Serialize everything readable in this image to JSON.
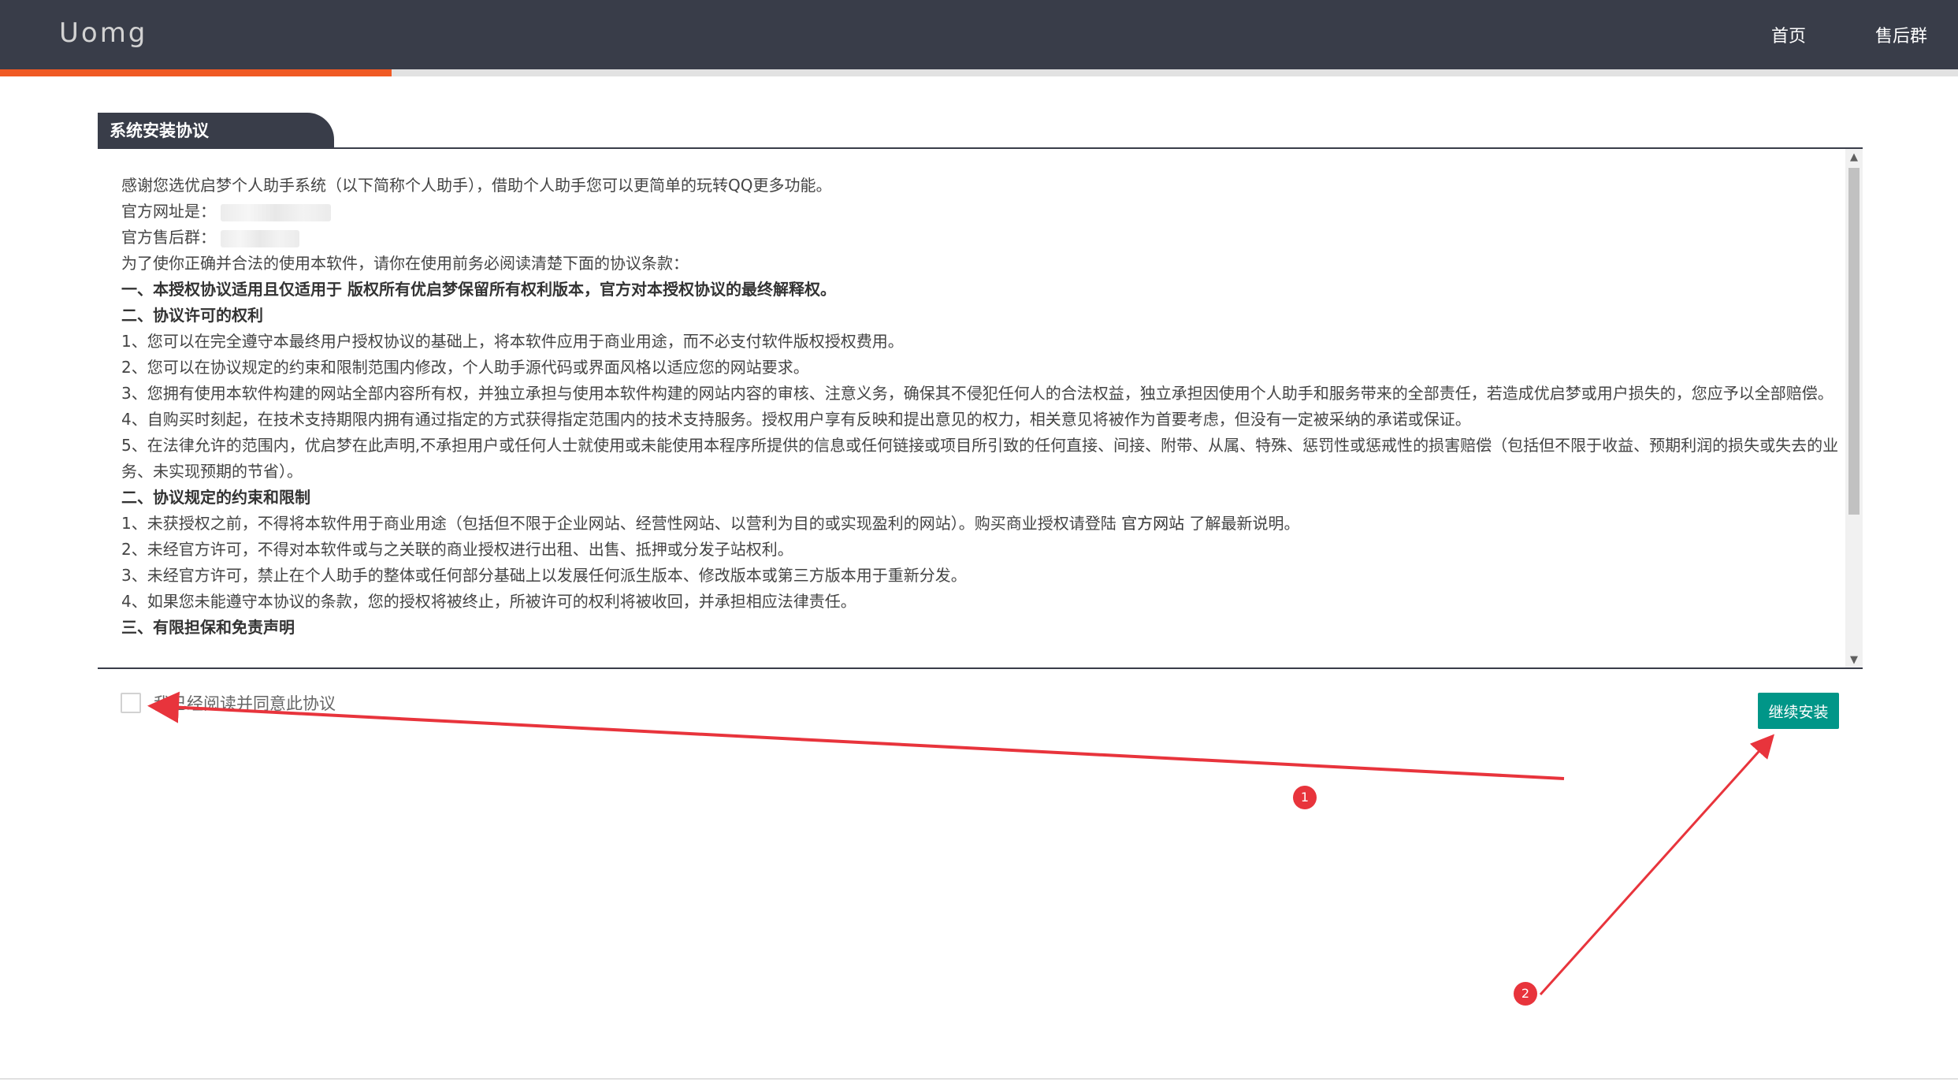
{
  "app": {
    "logo": "Uomg"
  },
  "nav": [
    {
      "label": "首页"
    },
    {
      "label": "售后群"
    }
  ],
  "progress": {
    "percent": 20,
    "color": "#f05a24"
  },
  "panel": {
    "title": "系统安装协议"
  },
  "agreement": {
    "intro": "感谢您选优启梦个人助手系统（以下简称个人助手），借助个人助手您可以更简单的玩转QQ更多功能。",
    "site_label": "官方网址是：",
    "group_label": "官方售后群：",
    "notice": "为了使你正确并合法的使用本软件，请你在使用前务必阅读清楚下面的协议条款：",
    "s1": "一、本授权协议适用且仅适用于 版权所有优启梦保留所有权利版本，官方对本授权协议的最终解释权。",
    "s2": "二、协议许可的权利",
    "s2_1": "1、您可以在完全遵守本最终用户授权协议的基础上，将本软件应用于商业用途，而不必支付软件版权授权费用。",
    "s2_2": "2、您可以在协议规定的约束和限制范围内修改，个人助手源代码或界面风格以适应您的网站要求。",
    "s2_3": "3、您拥有使用本软件构建的网站全部内容所有权，并独立承担与使用本软件构建的网站内容的审核、注意义务，确保其不侵犯任何人的合法权益，独立承担因使用个人助手和服务带来的全部责任，若造成优启梦或用户损失的，您应予以全部赔偿。",
    "s2_4": "4、自购买时刻起，在技术支持期限内拥有通过指定的方式获得指定范围内的技术支持服务。授权用户享有反映和提出意见的权力，相关意见将被作为首要考虑，但没有一定被采纳的承诺或保证。",
    "s2_5": "5、在法律允许的范围内，优启梦在此声明,不承担用户或任何人士就使用或未能使用本程序所提供的信息或任何链接或项目所引致的任何直接、间接、附带、从属、特殊、惩罚性或惩戒性的损害赔偿（包括但不限于收益、预期利润的损失或失去的业务、未实现预期的节省）。",
    "s3": "二、协议规定的约束和限制",
    "s3_1_pre": "1、未获授权之前，不得将本软件用于商业用途（包括但不限于企业网站、经营性网站、以营利为目的或实现盈利的网站）。购买商业授权请登陆 ",
    "s3_1_link": "官方网站",
    "s3_1_post": " 了解最新说明。",
    "s3_2": "2、未经官方许可，不得对本软件或与之关联的商业授权进行出租、出售、抵押或分发子站权利。",
    "s3_3": "3、未经官方许可，禁止在个人助手的整体或任何部分基础上以发展任何派生版本、修改版本或第三方版本用于重新分发。",
    "s3_4": "4、如果您未能遵守本协议的条款，您的授权将被终止，所被许可的权利将被收回，并承担相应法律责任。",
    "s4": "三、有限担保和免责声明"
  },
  "agree": {
    "label": "我已经阅读并同意此协议",
    "checked": false
  },
  "continue_button": {
    "label": "继续安装",
    "color": "#009688"
  },
  "annotations": [
    {
      "label": "1"
    },
    {
      "label": "2"
    }
  ]
}
